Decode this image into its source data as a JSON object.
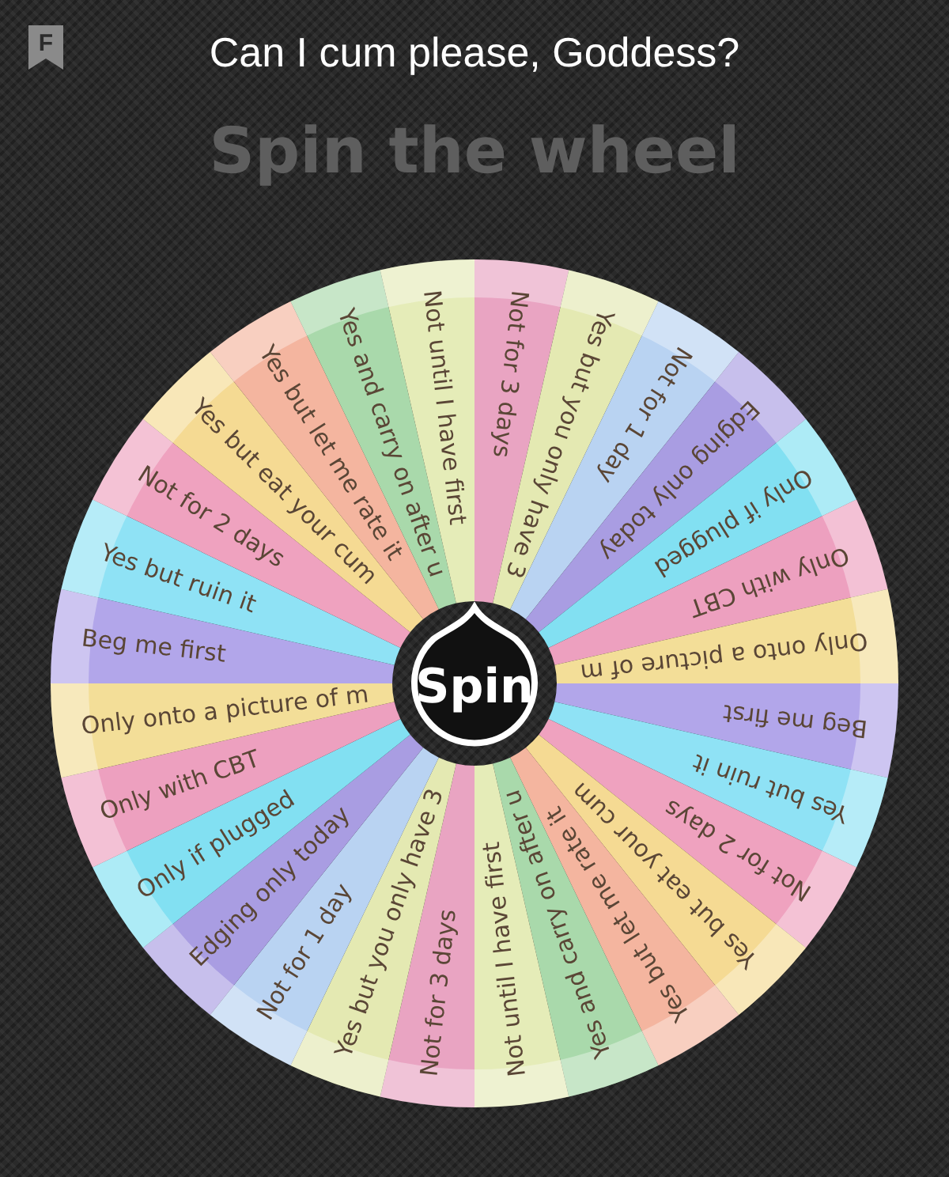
{
  "header": {
    "logo_letter": "F",
    "title": "Can I cum please, Goddess?"
  },
  "heading": "Spin the wheel",
  "wheel": {
    "segments": [
      {
        "label": "Not for 3 days",
        "color": "#e9a4c2"
      },
      {
        "label": "Yes but you only have 3",
        "color": "#e4e9b2"
      },
      {
        "label": "Not for 1 day",
        "color": "#b9d3f2"
      },
      {
        "label": "Edging only today",
        "color": "#a99de2"
      },
      {
        "label": "Only if plugged",
        "color": "#82e0f2"
      },
      {
        "label": "Only with CBT",
        "color": "#eda0bf"
      },
      {
        "label": "Only onto a picture of m",
        "color": "#f3de98"
      },
      {
        "label": "Beg me first",
        "color": "#b2a6ea"
      },
      {
        "label": "Yes but ruin it",
        "color": "#8fe2f5"
      },
      {
        "label": "Not for 2 days",
        "color": "#efa2bf"
      },
      {
        "label": "Yes but eat your cum",
        "color": "#f5da93"
      },
      {
        "label": "Yes but let me rate it",
        "color": "#f4b59f"
      },
      {
        "label": "Yes and carry on after u",
        "color": "#a9d9ab"
      },
      {
        "label": "Not until I have first",
        "color": "#e5ecb8"
      },
      {
        "label": "Not for 3 days",
        "color": "#e9a4c2"
      },
      {
        "label": "Yes but you only have 3",
        "color": "#e4e9b2"
      },
      {
        "label": "Not for 1 day",
        "color": "#b9d3f2"
      },
      {
        "label": "Edging only today",
        "color": "#a99de2"
      },
      {
        "label": "Only if plugged",
        "color": "#82e0f2"
      },
      {
        "label": "Only with CBT",
        "color": "#eda0bf"
      },
      {
        "label": "Only onto a picture of m",
        "color": "#f3de98"
      },
      {
        "label": "Beg me first",
        "color": "#b2a6ea"
      },
      {
        "label": "Yes but ruin it",
        "color": "#8fe2f5"
      },
      {
        "label": "Not for 2 days",
        "color": "#efa2bf"
      },
      {
        "label": "Yes but eat your cum",
        "color": "#f5da93"
      },
      {
        "label": "Yes but let me rate it",
        "color": "#f4b59f"
      },
      {
        "label": "Yes and carry on after u",
        "color": "#a9d9ab"
      },
      {
        "label": "Not until I have first",
        "color": "#e5ecb8"
      }
    ],
    "button": "Spin"
  }
}
